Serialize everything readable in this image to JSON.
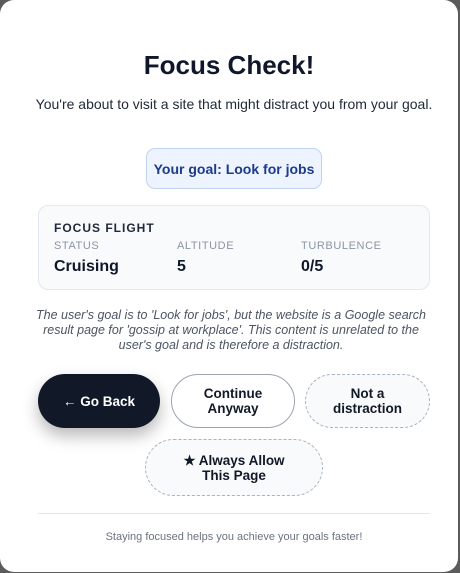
{
  "title": "Focus Check!",
  "subtitle": "You're about to visit a site that might distract you from your goal.",
  "goal": {
    "label": "Your goal: Look for jobs"
  },
  "focus_flight": {
    "heading": "FOCUS FLIGHT",
    "stats": [
      {
        "label": "STATUS",
        "value": "Cruising"
      },
      {
        "label": "ALTITUDE",
        "value": "5"
      },
      {
        "label": "TURBULENCE",
        "value": "0/5"
      }
    ]
  },
  "explanation": "The user's goal is to 'Look for jobs', but the website is a Google search result page for 'gossip at workplace'. This content is unrelated to the user's goal and is therefore a distraction.",
  "buttons": {
    "go_back": "← Go Back",
    "continue_line1": "Continue",
    "continue_line2": "Anyway",
    "not_distraction_line1": "Not a",
    "not_distraction_line2": "distraction",
    "always_allow_line1": "★ Always Allow",
    "always_allow_line2": "This Page"
  },
  "footer": "Staying focused helps you achieve your goals faster!",
  "colors": {
    "primary_button": "#111827",
    "goal_pill_bg": "#eef4ff",
    "goal_text": "#1e3a8a",
    "card_bg": "#f8fafc"
  }
}
